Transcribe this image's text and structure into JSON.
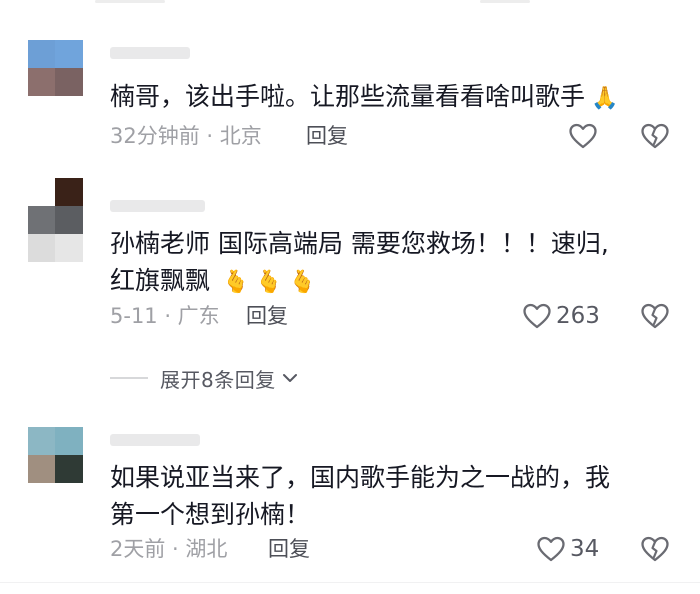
{
  "comments": [
    {
      "text_lines": [
        "楠哥，该出手啦。让那些流量看看啥叫歌手"
      ],
      "emoji": "🙏",
      "meta": "32分钟前 · 北京",
      "reply_label": "回复",
      "like_count": ""
    },
    {
      "text_lines": [
        "孙楠老师 国际高端局 需要您救场！！！速归,",
        "红旗飘飘"
      ],
      "emoji": "🫰🫰🫰",
      "meta": "5-11 · 广东",
      "reply_label": "回复",
      "like_count": "263"
    },
    {
      "text_lines": [
        "如果说亚当来了，国内歌手能为之一战的，我",
        "第一个想到孙楠！"
      ],
      "emoji": "",
      "meta": "2天前 · 湖北",
      "reply_label": "回复",
      "like_count": "34"
    }
  ],
  "expand_replies": {
    "label": "展开8条回复"
  },
  "icons": {
    "like": "heart-outline-icon",
    "dislike": "broken-heart-icon",
    "expand": "chevron-down-icon"
  },
  "colors": {
    "text": "#161823",
    "meta": "#9fa0a5",
    "action": "#4d4f57",
    "icon": "#6a6b72"
  }
}
